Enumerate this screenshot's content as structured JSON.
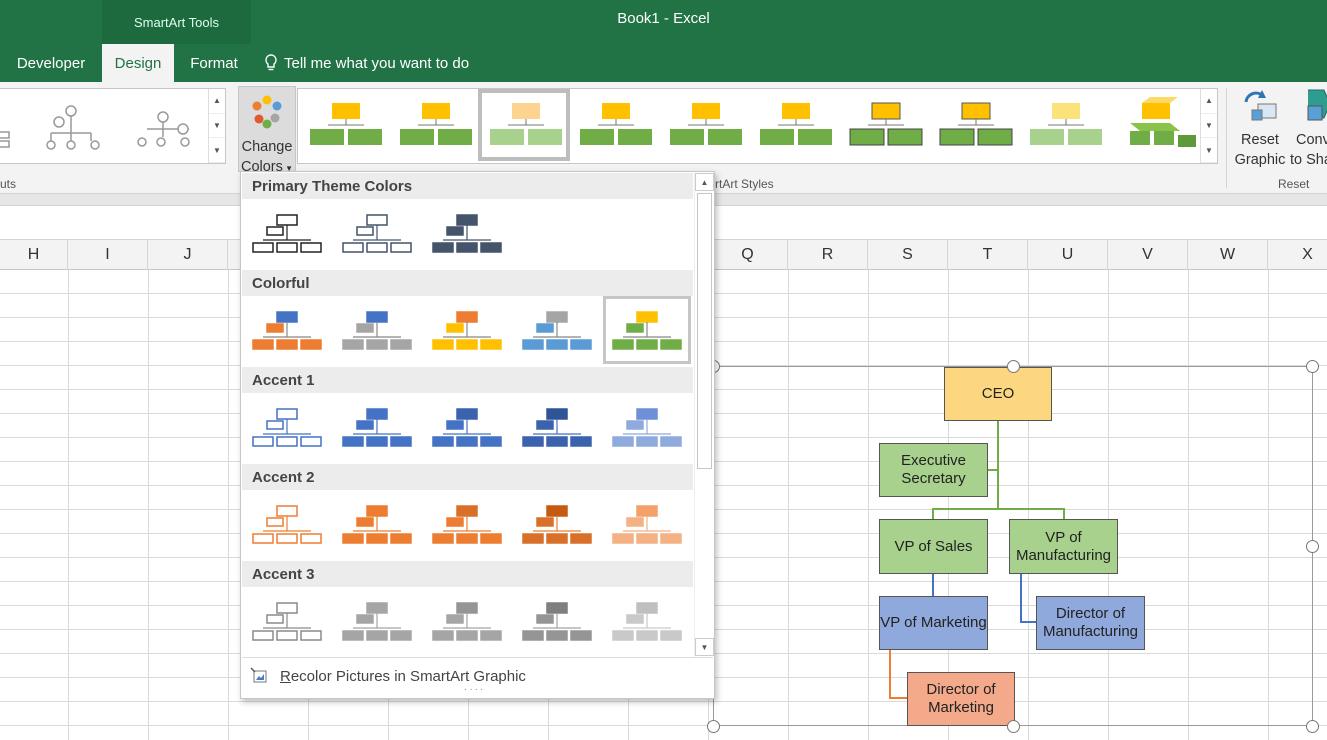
{
  "titlebar": {
    "context_tab_group": "SmartArt Tools",
    "document_title": "Book1  -  Excel"
  },
  "tabs": [
    {
      "label": "Developer"
    },
    {
      "label": "Design",
      "active": true
    },
    {
      "label": "Format"
    }
  ],
  "tell_me": {
    "text": "Tell me what you want to do"
  },
  "ribbon": {
    "layouts_group_label": "uts",
    "styles_group_label": "rtArt Styles",
    "change_colors": {
      "line1": "Change",
      "line2": "Colors"
    },
    "reset_group_label": "Reset",
    "reset_graphic": {
      "line1": "Reset",
      "line2": "Graphic"
    },
    "convert": {
      "line1": "Conv",
      "line2": "to Sha"
    }
  },
  "columns": [
    "H",
    "I",
    "J",
    "Q",
    "R",
    "S",
    "T",
    "U",
    "V",
    "W",
    "X"
  ],
  "dropdown": {
    "sections": [
      {
        "title": "Primary Theme Colors"
      },
      {
        "title": "Colorful"
      },
      {
        "title": "Accent 1"
      },
      {
        "title": "Accent 2"
      },
      {
        "title": "Accent 3"
      }
    ],
    "footer_text": "Recolor Pictures in SmartArt Graphic",
    "footer_hotkey": "R",
    "footer_rest": "ecolor Pictures in SmartArt Graphic",
    "selected": "Colorful - Accent 6 (green)"
  },
  "smartart": {
    "nodes": [
      {
        "label": "CEO",
        "fill": "#fcd77f"
      },
      {
        "label": "Executive Secretary",
        "fill": "#a9d18e"
      },
      {
        "label": "VP of Sales",
        "fill": "#a9d18e"
      },
      {
        "label": "VP of Manufacturing",
        "fill": "#a9d18e"
      },
      {
        "label": "VP of Marketing",
        "fill": "#8fa9dc"
      },
      {
        "label": "Director of Manufacturing",
        "fill": "#8fa9dc"
      },
      {
        "label": "Director of Marketing",
        "fill": "#f4a98a"
      }
    ]
  },
  "colors": {
    "excel_green": "#217346",
    "accent_orange": "#ed7d31",
    "accent_gray": "#a5a5a5",
    "accent_gold": "#ffc000",
    "accent_blue": "#5b9bd5",
    "accent_green": "#70ad47",
    "accent1_blue": "#4472c4"
  }
}
